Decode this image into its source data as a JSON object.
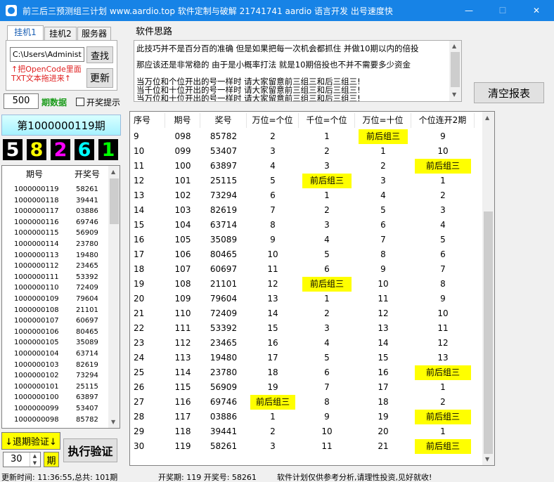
{
  "window": {
    "title": "前三后三预测组三计划 www.aardio.top 软件定制与破解 21741741 aardio 语言开发 出号速度快",
    "minimize": "—",
    "maximize": "☐",
    "close": "✕"
  },
  "tabs": [
    "挂机1",
    "挂机2",
    "服务器"
  ],
  "path_value": "C:\\Users\\Administ",
  "find_button": "查找",
  "hint_lines": [
    "↑把OpenCode里面",
    "TXT文本拖进来↑"
  ],
  "update_button": "更新",
  "count_value": "500",
  "count_label": "期数据",
  "lottery_checkbox_label": "开奖提示",
  "current_period": "第1000000119期",
  "digits": [
    {
      "value": "5",
      "color": "#ffffff"
    },
    {
      "value": "8",
      "color": "#ffff00"
    },
    {
      "value": "2",
      "color": "#ff00ff"
    },
    {
      "value": "6",
      "color": "#00ffff"
    },
    {
      "value": "1",
      "color": "#00ff00"
    }
  ],
  "left_table": {
    "headers": [
      "期号",
      "开奖号"
    ],
    "rows": [
      [
        "1000000119",
        "58261"
      ],
      [
        "1000000118",
        "39441"
      ],
      [
        "1000000117",
        "03886"
      ],
      [
        "1000000116",
        "69746"
      ],
      [
        "1000000115",
        "56909"
      ],
      [
        "1000000114",
        "23780"
      ],
      [
        "1000000113",
        "19480"
      ],
      [
        "1000000112",
        "23465"
      ],
      [
        "1000000111",
        "53392"
      ],
      [
        "1000000110",
        "72409"
      ],
      [
        "1000000109",
        "79604"
      ],
      [
        "1000000108",
        "21101"
      ],
      [
        "1000000107",
        "60697"
      ],
      [
        "1000000106",
        "80465"
      ],
      [
        "1000000105",
        "35089"
      ],
      [
        "1000000104",
        "63714"
      ],
      [
        "1000000103",
        "82619"
      ],
      [
        "1000000102",
        "73294"
      ],
      [
        "1000000101",
        "25115"
      ],
      [
        "1000000100",
        "63897"
      ],
      [
        "1000000099",
        "53407"
      ],
      [
        "1000000098",
        "85782"
      ]
    ]
  },
  "backtest_button": "↓退期验证↓",
  "backtest_value": "30",
  "period_label": "期",
  "execute_button": "执行验证",
  "section_label": "软件思路",
  "notes_lines": [
    "此技巧并不是百分百的准确 但是如果把每一次机会都抓住 并做10期以内的倍投",
    "那应该还是非常稳的    由于是小概率打法   就是10期倍投也不并不需要多少资金",
    "当万位和个位开出的号一样时 请大家留意前三组三和后三组三!",
    "当千位和十位开出的号一样时 请大家留意前三组三和后三组三!",
    "当万位和十位开出的号一样时 请大家留意前三组三和后三组三!"
  ],
  "clear_button": "清空报表",
  "main_table": {
    "headers": [
      "序号",
      "期号",
      "奖号",
      "万位=个位",
      "千位=个位",
      "万位=十位",
      "个位连开2期"
    ],
    "rows": [
      [
        "9",
        "098",
        "85782",
        "2",
        "1",
        "前后组三",
        "9"
      ],
      [
        "10",
        "099",
        "53407",
        "3",
        "2",
        "1",
        "10"
      ],
      [
        "11",
        "100",
        "63897",
        "4",
        "3",
        "2",
        "前后组三"
      ],
      [
        "12",
        "101",
        "25115",
        "5",
        "前后组三",
        "3",
        "1"
      ],
      [
        "13",
        "102",
        "73294",
        "6",
        "1",
        "4",
        "2"
      ],
      [
        "14",
        "103",
        "82619",
        "7",
        "2",
        "5",
        "3"
      ],
      [
        "15",
        "104",
        "63714",
        "8",
        "3",
        "6",
        "4"
      ],
      [
        "16",
        "105",
        "35089",
        "9",
        "4",
        "7",
        "5"
      ],
      [
        "17",
        "106",
        "80465",
        "10",
        "5",
        "8",
        "6"
      ],
      [
        "18",
        "107",
        "60697",
        "11",
        "6",
        "9",
        "7"
      ],
      [
        "19",
        "108",
        "21101",
        "12",
        "前后组三",
        "10",
        "8"
      ],
      [
        "20",
        "109",
        "79604",
        "13",
        "1",
        "11",
        "9"
      ],
      [
        "21",
        "110",
        "72409",
        "14",
        "2",
        "12",
        "10"
      ],
      [
        "22",
        "111",
        "53392",
        "15",
        "3",
        "13",
        "11"
      ],
      [
        "23",
        "112",
        "23465",
        "16",
        "4",
        "14",
        "12"
      ],
      [
        "24",
        "113",
        "19480",
        "17",
        "5",
        "15",
        "13"
      ],
      [
        "25",
        "114",
        "23780",
        "18",
        "6",
        "16",
        "前后组三"
      ],
      [
        "26",
        "115",
        "56909",
        "19",
        "7",
        "17",
        "1"
      ],
      [
        "27",
        "116",
        "69746",
        "前后组三",
        "8",
        "18",
        "2"
      ],
      [
        "28",
        "117",
        "03886",
        "1",
        "9",
        "19",
        "前后组三"
      ],
      [
        "29",
        "118",
        "39441",
        "2",
        "10",
        "20",
        "1"
      ],
      [
        "30",
        "119",
        "58261",
        "3",
        "11",
        "21",
        "前后组三"
      ]
    ]
  },
  "highlight_value": "前后组三",
  "highlight_color": "#ffff00",
  "status": {
    "update_time": "更新时间: 11:36:55,总共: 101期",
    "draw": "开奖期: 119 开奖号: 58261",
    "disclaimer": "软件计划仅供参考分析,请理性投资,见好就收!"
  }
}
